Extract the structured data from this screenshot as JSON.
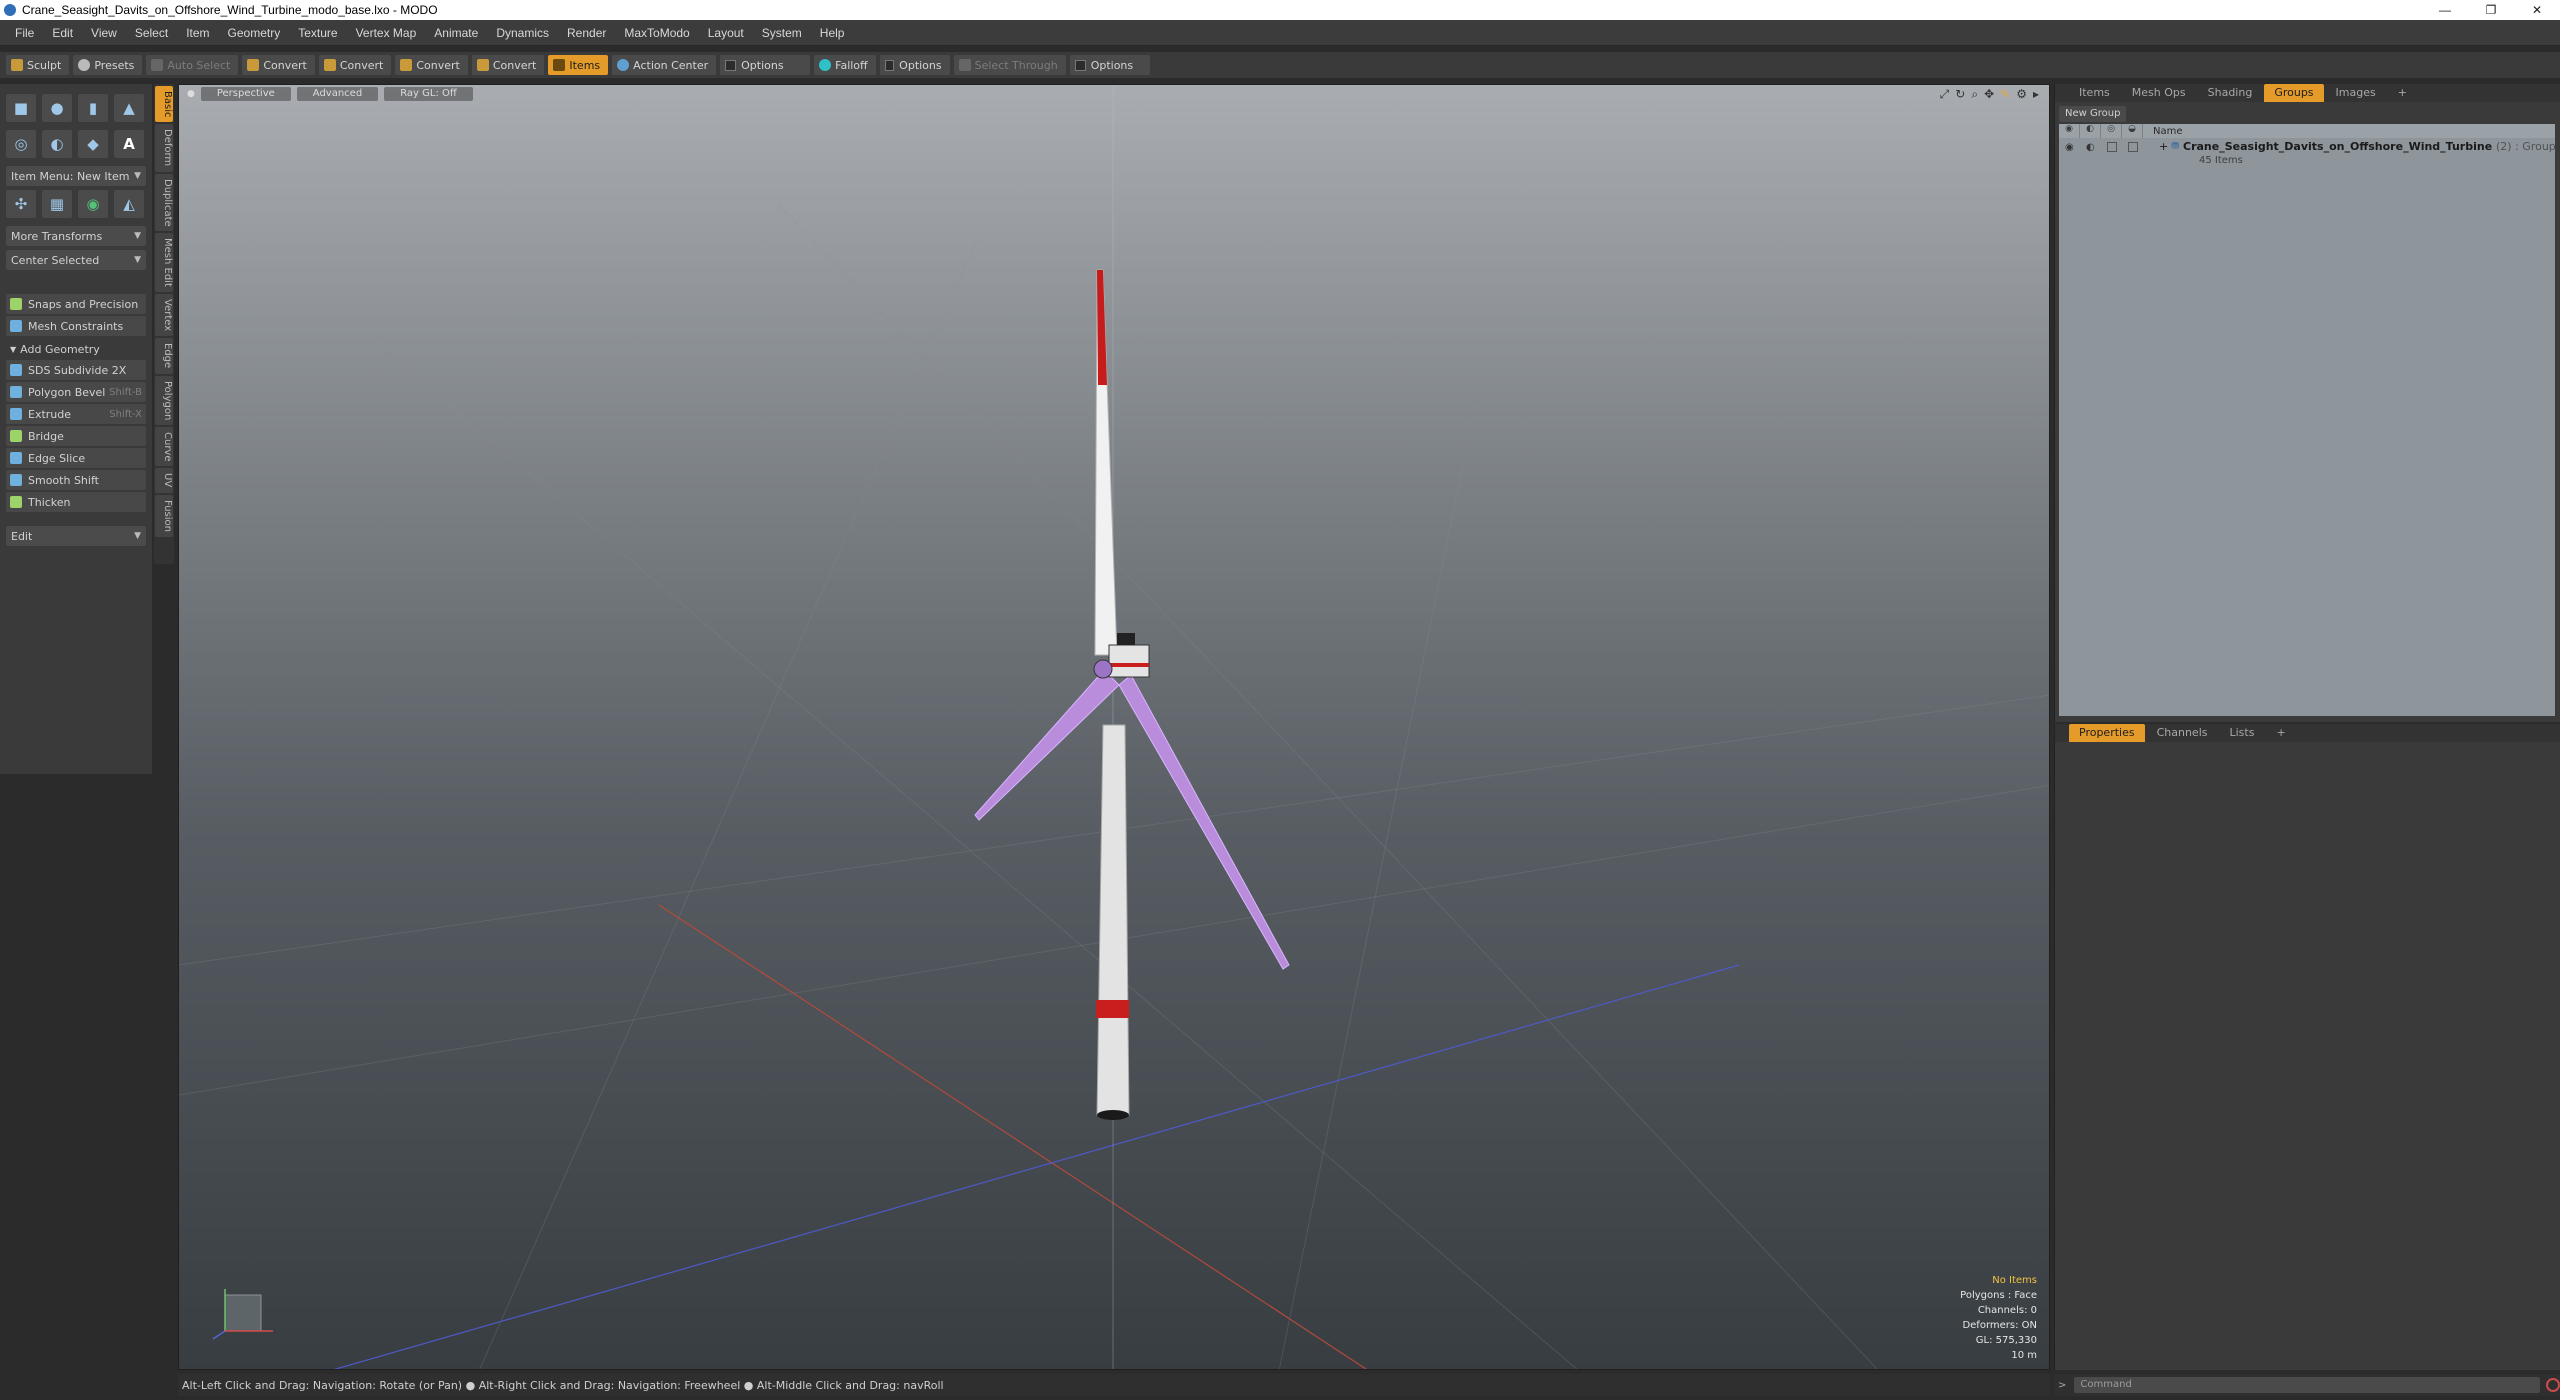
{
  "window": {
    "title": "Crane_Seasight_Davits_on_Offshore_Wind_Turbine_modo_base.lxo - MODO",
    "min": "—",
    "max": "❐",
    "close": "✕"
  },
  "menu": [
    "File",
    "Edit",
    "View",
    "Select",
    "Item",
    "Geometry",
    "Texture",
    "Vertex Map",
    "Animate",
    "Dynamics",
    "Render",
    "MaxToModo",
    "Layout",
    "System",
    "Help"
  ],
  "toolbar": {
    "sculpt": "Sculpt",
    "presets": "Presets",
    "auto_select": "Auto Select",
    "convert1": "Convert",
    "convert2": "Convert",
    "convert3": "Convert",
    "convert4": "Convert",
    "items": "Items",
    "action_center": "Action Center",
    "options1": "Options",
    "falloff": "Falloff",
    "options2": "Options",
    "select_through": "Select Through",
    "options3": "Options"
  },
  "leftpanel": {
    "item_menu": "Item Menu: New Item",
    "more_transforms": "More Transforms",
    "center_selected": "Center Selected",
    "snaps": "Snaps and Precision",
    "mesh_constraints": "Mesh Constraints",
    "add_geometry": "Add Geometry",
    "tools": [
      {
        "label": "SDS Subdivide 2X",
        "shortcut": ""
      },
      {
        "label": "Polygon Bevel",
        "shortcut": "Shift-B"
      },
      {
        "label": "Extrude",
        "shortcut": "Shift-X"
      },
      {
        "label": "Bridge",
        "shortcut": ""
      },
      {
        "label": "Edge Slice",
        "shortcut": ""
      },
      {
        "label": "Smooth Shift",
        "shortcut": ""
      },
      {
        "label": "Thicken",
        "shortcut": ""
      }
    ],
    "edit": "Edit"
  },
  "vtabs": [
    "Basic",
    "Deform",
    "Duplicate",
    "Mesh Edit",
    "Vertex",
    "Edge",
    "Polygon",
    "Curve",
    "UV",
    "Fusion"
  ],
  "viewport": {
    "perspective": "Perspective",
    "advanced": "Advanced",
    "raygl": "Ray GL: Off",
    "info": {
      "selection": "No Items",
      "polygons": "Polygons : Face",
      "channels": "Channels: 0",
      "deformers": "Deformers: ON",
      "gl": "GL: 575,330",
      "scale": "10 m"
    }
  },
  "statusbar": "Alt-Left Click and Drag: Navigation: Rotate (or Pan) ● Alt-Right Click and Drag: Navigation: Freewheel ● Alt-Middle Click and Drag: navRoll",
  "rtop": {
    "tabs": [
      "Items",
      "Mesh Ops",
      "Shading",
      "Groups",
      "Images",
      "+"
    ],
    "new_group": "New Group",
    "name_header": "Name",
    "group_name": "Crane_Seasight_Davits_on_Offshore_Wind_Turbine",
    "group_count": "(2) : Group",
    "group_items": "45 Items"
  },
  "rbottom": {
    "tabs": [
      "Properties",
      "Channels",
      "Lists",
      "+"
    ]
  },
  "command": {
    "placeholder": "Command"
  }
}
